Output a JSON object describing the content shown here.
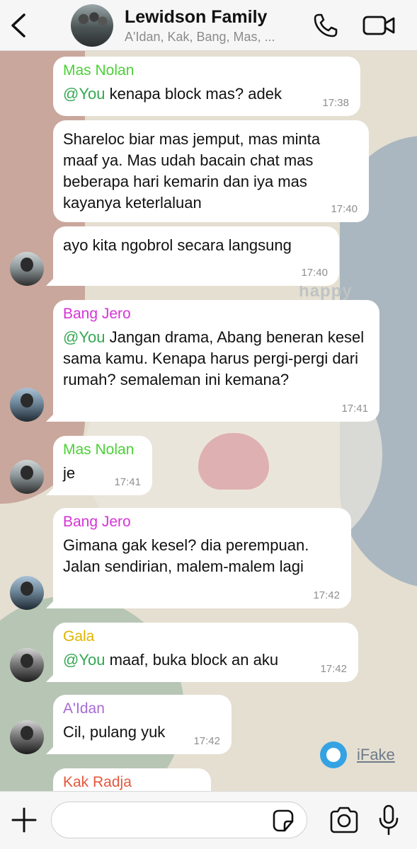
{
  "header": {
    "title": "Lewidson Family",
    "subtitle": "A'Idan, Kak, Bang, Mas, ..."
  },
  "wallpaper_text": "happy",
  "messages": [
    {
      "sender": "Mas Nolan",
      "mention": "@You",
      "text": " kenapa block mas? adek",
      "time": "17:38"
    },
    {
      "text": "Shareloc biar mas jemput, mas minta maaf ya. Mas udah bacain chat mas beberapa hari kemarin dan iya mas kayanya keterlaluan",
      "time": "17:40"
    },
    {
      "text": "ayo kita ngobrol secara langsung",
      "time": "17:40"
    },
    {
      "sender": "Bang Jero",
      "mention": "@You",
      "text": " Jangan drama, Abang beneran kesel sama kamu. Kenapa harus pergi-pergi dari rumah? semaleman ini kemana?",
      "time": "17:41"
    },
    {
      "sender": "Mas Nolan",
      "text": "je",
      "time": "17:41"
    },
    {
      "sender": "Bang Jero",
      "text": "Gimana gak kesel? dia perempuan. Jalan sendirian, malem-malem lagi",
      "time": "17:42"
    },
    {
      "sender": "Gala",
      "mention": "@You",
      "text": " maaf, buka block an aku",
      "time": "17:42"
    },
    {
      "sender": "A'Idan",
      "text": "Cil, pulang yuk",
      "time": "17:42"
    },
    {
      "sender": "Kak Radja"
    }
  ],
  "colors": {
    "mas_nolan": "#4cd137",
    "bang_jero": "#d633d6",
    "gala": "#e0b400",
    "aidan": "#a66bd6",
    "kak_radja": "#e4583e",
    "mention": "#34a853"
  },
  "watermark": {
    "text": "iFake"
  },
  "composer": {
    "placeholder": ""
  }
}
